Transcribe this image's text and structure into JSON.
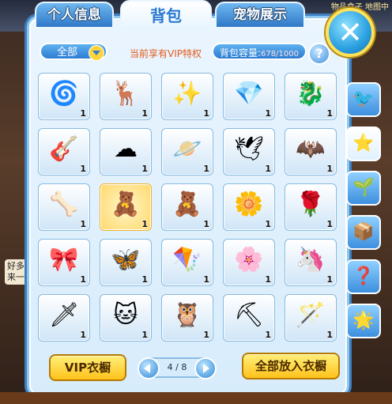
{
  "background": {
    "left_chat": "好多来一",
    "top_right": "物品盒子 地图中"
  },
  "tabs": [
    {
      "label": "个人信息",
      "active": false
    },
    {
      "label": "背包",
      "active": true
    },
    {
      "label": "宠物展示",
      "active": false
    }
  ],
  "close_icon": "close-x-icon",
  "toolbar": {
    "filter_value": "全部",
    "vip_notice": "当前享有VIP特权",
    "capacity_label": "背包容量:",
    "capacity_value": "678/1000",
    "help_label": "?"
  },
  "items": [
    {
      "icon": "silver-frame",
      "glyph": "🌀",
      "count": "1"
    },
    {
      "icon": "dark-antlers",
      "glyph": "🦌",
      "count": "1"
    },
    {
      "icon": "light-rays",
      "glyph": "✨",
      "count": "1"
    },
    {
      "icon": "pink-crystal",
      "glyph": "💎",
      "count": "1"
    },
    {
      "icon": "dragon-frame",
      "glyph": "🐉",
      "count": "1"
    },
    {
      "icon": "guitar",
      "glyph": "🎸",
      "count": "1"
    },
    {
      "icon": "clouds",
      "glyph": "☁",
      "count": "1"
    },
    {
      "icon": "planets",
      "glyph": "🪐",
      "count": "1"
    },
    {
      "icon": "silver-wings",
      "glyph": "🕊",
      "count": "1"
    },
    {
      "icon": "black-wings",
      "glyph": "🦇",
      "count": "1"
    },
    {
      "icon": "skeleton-wings",
      "glyph": "🦴",
      "count": "1"
    },
    {
      "icon": "bear-plush-selected",
      "glyph": "🧸",
      "count": "1",
      "selected": true
    },
    {
      "icon": "bear-plush",
      "glyph": "🧸",
      "count": "1"
    },
    {
      "icon": "flower-garland",
      "glyph": "🌼",
      "count": "1"
    },
    {
      "icon": "rose-wreath",
      "glyph": "🌹",
      "count": "1"
    },
    {
      "icon": "twin-bows",
      "glyph": "🎀",
      "count": "1"
    },
    {
      "icon": "fairy-wings",
      "glyph": "🦋",
      "count": "1"
    },
    {
      "icon": "red-kite",
      "glyph": "🪁",
      "count": "1"
    },
    {
      "icon": "pink-flower-wand",
      "glyph": "🌸",
      "count": "1"
    },
    {
      "icon": "unicorn",
      "glyph": "🦄",
      "count": "1"
    },
    {
      "icon": "blue-sword",
      "glyph": "🗡",
      "count": "1"
    },
    {
      "icon": "fox-cat",
      "glyph": "🐱",
      "count": "1"
    },
    {
      "icon": "owl",
      "glyph": "🦉",
      "count": "1"
    },
    {
      "icon": "pickaxe",
      "glyph": "⛏",
      "count": "1"
    },
    {
      "icon": "magic-wand",
      "glyph": "🪄",
      "count": "1"
    }
  ],
  "side_tabs": [
    {
      "icon": "robot-bird-icon",
      "glyph": "🐦",
      "active": false
    },
    {
      "icon": "star-card-icon",
      "glyph": "⭐",
      "active": true
    },
    {
      "icon": "seed-bag-icon",
      "glyph": "🌱",
      "active": false
    },
    {
      "icon": "box-icon",
      "glyph": "📦",
      "active": false
    },
    {
      "icon": "question-icon",
      "glyph": "❓",
      "active": false
    },
    {
      "icon": "purple-star-icon",
      "glyph": "🌟",
      "active": false
    }
  ],
  "footer": {
    "vip_wardrobe": "VIP衣橱",
    "page": "4 / 8",
    "put_all": "全部放入衣橱"
  }
}
